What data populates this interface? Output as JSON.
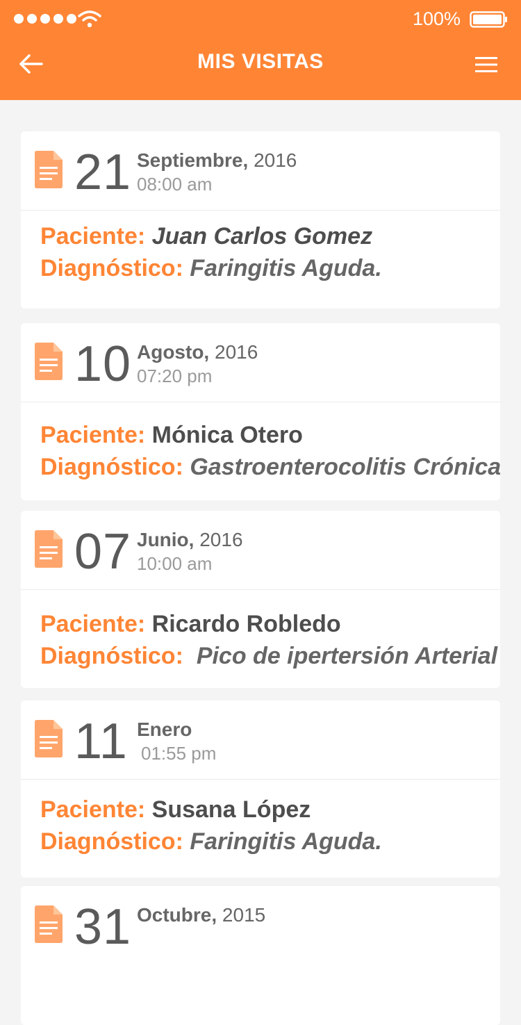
{
  "status_bar": {
    "battery_percent": "100%"
  },
  "nav": {
    "title": "MIS VISITAS"
  },
  "labels": {
    "patient": "Paciente:",
    "diagnosis": "Diagnóstico:"
  },
  "visits": [
    {
      "day": "21",
      "month": "Septiembre,",
      "year": "2016",
      "time": "08:00 am",
      "patient": "Juan Carlos Gomez",
      "diagnosis": "Faringitis Aguda."
    },
    {
      "day": "10",
      "month": "Agosto,",
      "year": "2016",
      "time": "07:20 pm",
      "patient": "Mónica Otero",
      "diagnosis": "Gastroenterocolitis Crónica."
    },
    {
      "day": "07",
      "month": "Junio,",
      "year": "2016",
      "time": "10:00 am",
      "patient": "Ricardo Robledo",
      "diagnosis": "Pico de ipertersión Arterial"
    },
    {
      "day": "11",
      "month": "Enero",
      "year": "",
      "time": "01:55 pm",
      "patient": "Susana López",
      "diagnosis": "Faringitis Aguda."
    },
    {
      "day": "31",
      "month": "Octubre,",
      "year": "2015",
      "time": "",
      "patient": "",
      "diagnosis": ""
    }
  ],
  "colors": {
    "accent": "#ff8535",
    "background": "#f4f4f4",
    "card": "#ffffff",
    "icon": "#ffa56b"
  },
  "icons": {
    "back": "arrow-left-icon",
    "menu": "hamburger-menu-icon",
    "visit": "document-icon",
    "wifi": "wifi-icon",
    "battery": "battery-icon",
    "signal": "signal-dots-icon"
  }
}
